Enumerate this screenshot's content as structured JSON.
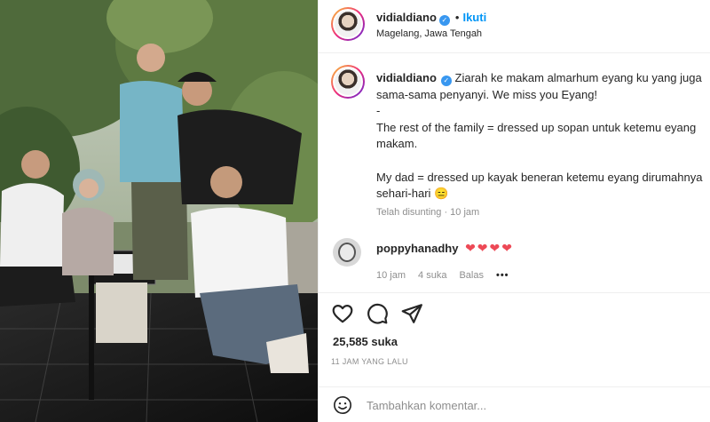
{
  "post": {
    "photo_alt_icon": "group-photo",
    "author": {
      "username": "vidialdiano",
      "verified_icon": "verified-badge-icon",
      "follow_label": "Ikuti",
      "location": "Magelang, Jawa Tengah"
    },
    "caption": {
      "username": "vidialdiano",
      "text": "Ziarah ke makam almarhum eyang ku yang juga\nsama-sama penyanyi. We miss you Eyang!\n-\nThe rest of the family = dressed up sopan untuk ketemu eyang\nmakam.\n\nMy dad = dressed up kayak beneran ketemu eyang dirumahnya\nsehari-hari 😑",
      "edited_label": "Telah disunting",
      "edited_time": "10 jam"
    },
    "comments": [
      {
        "username": "poppyhanadhy",
        "text": "❤❤❤❤",
        "time": "10 jam",
        "likes": "4 suka",
        "reply_label": "Balas",
        "more_label": "•••"
      }
    ],
    "actions": {
      "like_icon": "heart-icon",
      "comment_icon": "comment-icon",
      "share_icon": "share-icon"
    },
    "like_count": "25,585 suka",
    "posted_ago": "11 JAM YANG LALU",
    "add_comment": {
      "placeholder": "Tambahkan komentar...",
      "emoji_icon": "emoji-icon"
    }
  },
  "colors": {
    "accent": "#0095f6",
    "verified": "#3897f0",
    "heart": "#ed4956",
    "muted": "#8e8e8e"
  }
}
